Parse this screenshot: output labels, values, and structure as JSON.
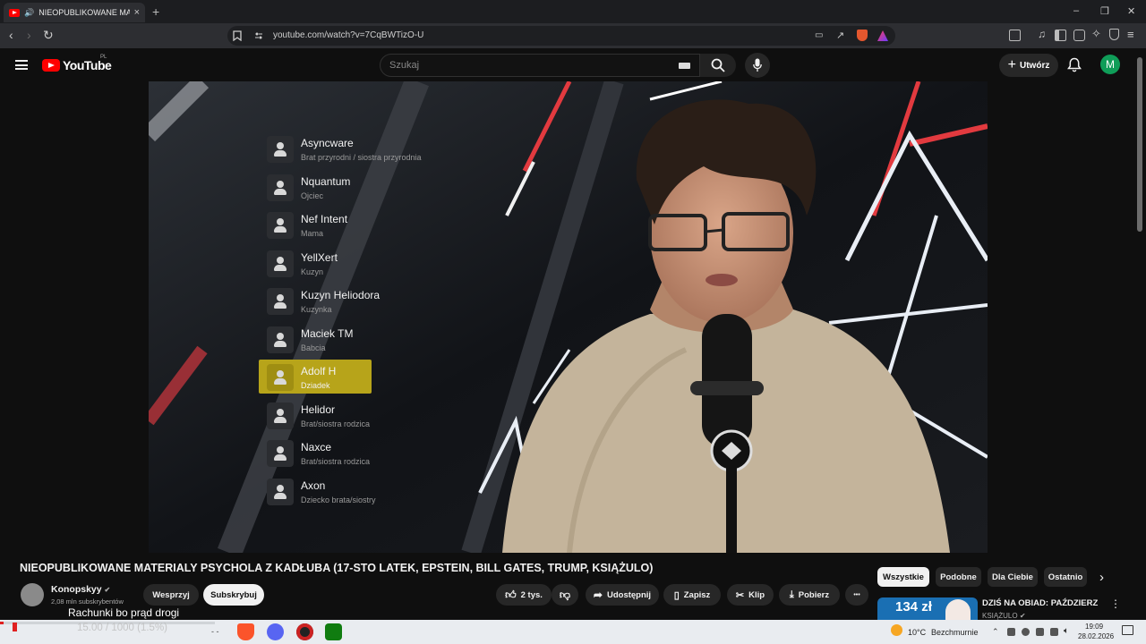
{
  "browser": {
    "tab_title": "NIEOPUBLIKOWANE MATERIA",
    "tab_close": "×",
    "new_tab": "+",
    "url": "youtube.com/watch?v=7CqBWTizO-U",
    "window_min": "–",
    "window_restore": "❐",
    "window_close": "✕"
  },
  "youtube": {
    "logo_text": "YouTube",
    "logo_region": "PL",
    "search_placeholder": "Szukaj",
    "create_label": "Utwórz",
    "avatar_letter": "M"
  },
  "video": {
    "family_list": [
      {
        "name": "Asyncware",
        "role": "Brat przyrodni / siostra przyrodnia"
      },
      {
        "name": "Nquantum",
        "role": "Ojciec"
      },
      {
        "name": "Nef Intent",
        "role": "Mama"
      },
      {
        "name": "YellXert",
        "role": "Kuzyn"
      },
      {
        "name": "Kuzyn Heliodora",
        "role": "Kuzynka"
      },
      {
        "name": "Maciek TM",
        "role": "Babcia"
      },
      {
        "name": "Adolf H",
        "role": "Dziadek"
      },
      {
        "name": "Helidor",
        "role": "Brat/siostra rodzica"
      },
      {
        "name": "Naxce",
        "role": "Brat/siostra rodzica"
      },
      {
        "name": "Axon",
        "role": "Dziecko brata/siostry"
      }
    ],
    "highlighted_index": 6
  },
  "below_video": {
    "title": "NIEOPUBLIKOWANE MATERIALY PSYCHOLA Z KADŁUBA (17-STO LATEK, EPSTEIN, BILL GATES, TRUMP, KSIĄŻULO)",
    "channel_name": "Konopskyy",
    "channel_subs": "2,08 mln subskrybentów",
    "support_label": "Wesprzyj",
    "subscribe_label": "Subskrybuj",
    "likes_label": "2 tys.",
    "share_label": "Udostępnij",
    "save_label": "Zapisz",
    "clip_label": "Klip",
    "download_label": "Pobierz",
    "more_label": "•••"
  },
  "chips": [
    "Wszystkie",
    "Podobne",
    "Dla Ciebie",
    "Ostatnio"
  ],
  "recommended": {
    "thumb_text": "134 zł",
    "title": "DZIŚ NA OBIAD: PAŹDZIERZ",
    "channel": "KSIĄŻULO"
  },
  "overlay": {
    "subtitle": "Rachunki bo prąd drogi",
    "counter": "15.00 / 1000 (1.5%)",
    "progress_fraction": 0.015
  },
  "taskbar": {
    "weather_temp": "10°C",
    "weather_desc": "Bezchmurnie",
    "time": "19:09",
    "date": "28.02.2026"
  },
  "colors": {
    "yt_red": "#ff0000",
    "highlight": "#b7a41a",
    "avatar": "#0f9d58"
  }
}
